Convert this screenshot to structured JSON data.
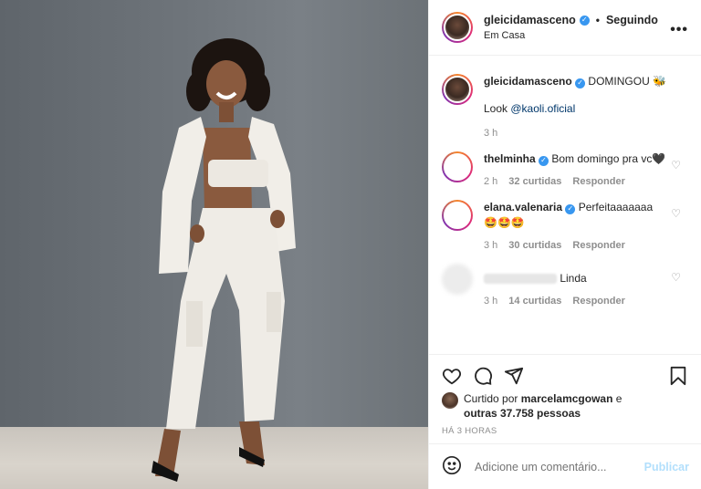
{
  "header": {
    "username": "gleicidamasceno",
    "separator": "•",
    "follow_label": "Seguindo",
    "location": "Em Casa",
    "more_label": "•••"
  },
  "caption": {
    "username": "gleicidamasceno",
    "text": "DOMINGOU",
    "emoji": "🐝",
    "look_prefix": "Look",
    "mention": "@kaoli.oficial",
    "time": "3 h"
  },
  "comments": [
    {
      "username": "thelminha",
      "text": "Bom domingo pra vc🖤",
      "time": "2 h",
      "likes": "32 curtidas",
      "reply": "Responder"
    },
    {
      "username": "elana.valenaria",
      "text": "Perfeitaaaaaaa",
      "emoji": "🤩🤩🤩",
      "time": "3 h",
      "likes": "30 curtidas",
      "reply": "Responder"
    },
    {
      "username": "",
      "text": "Linda",
      "time": "3 h",
      "likes": "14 curtidas",
      "reply": "Responder"
    }
  ],
  "likes": {
    "prefix": "Curtido por",
    "user": "marcelamcgowan",
    "suffix": "e",
    "others": "outras 37.758 pessoas"
  },
  "time_ago": "HÁ 3 HORAS",
  "add_comment": {
    "placeholder": "Adicione um comentário...",
    "publish_label": "Publicar"
  },
  "colors": {
    "verified": "#3897f0",
    "publish": "#b2dffc",
    "meta": "#8e8e8e"
  }
}
